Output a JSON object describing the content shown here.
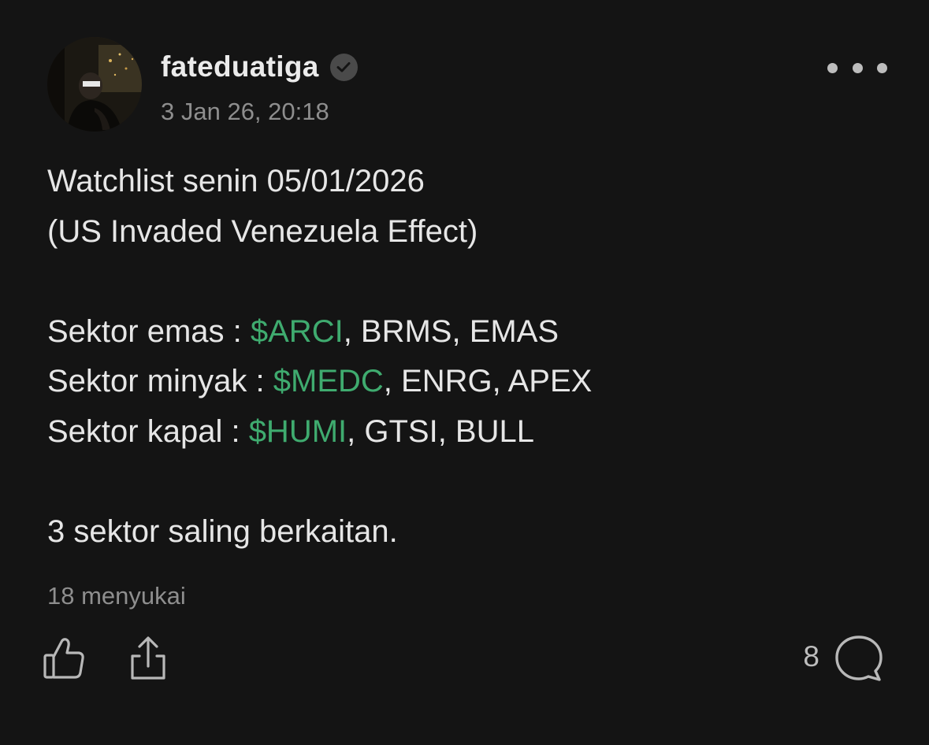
{
  "post": {
    "author": {
      "username": "fateduatiga",
      "verified": true,
      "avatar_icon": "avatar"
    },
    "timestamp": "3 Jan 26, 20:18",
    "content": {
      "line1": "Watchlist senin 05/01/2026",
      "line2": "(US Invaded Venezuela Effect)",
      "sectors": [
        {
          "label": "Sektor emas : ",
          "ticker": "$ARCI",
          "others": ", BRMS, EMAS"
        },
        {
          "label": "Sektor minyak : ",
          "ticker": "$MEDC",
          "others": ", ENRG, APEX"
        },
        {
          "label": "Sektor kapal : ",
          "ticker": "$HUMI",
          "others": ", GTSI, BULL"
        }
      ],
      "closing": "3 sektor saling berkaitan."
    },
    "likes_text": "18 menyukai",
    "comment_count": "8",
    "icons": {
      "more": "more-horizontal-icon",
      "like": "thumbs-up-icon",
      "share": "share-icon",
      "comment": "comment-bubble-icon",
      "verified": "verified-check-icon"
    },
    "colors": {
      "background": "#141414",
      "ticker": "#3fab6f",
      "muted": "#8e8e8e"
    }
  }
}
